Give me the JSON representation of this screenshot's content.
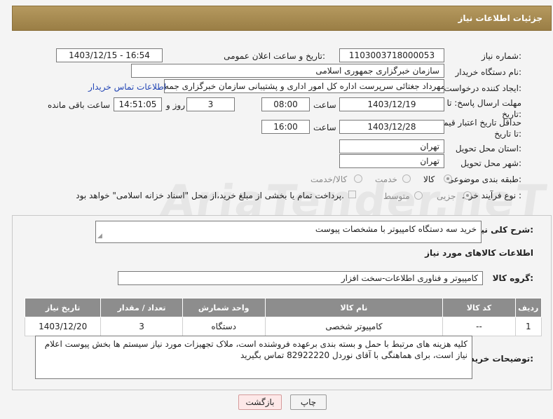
{
  "header": {
    "title": "جزئیات اطلاعات نیاز"
  },
  "form": {
    "need_number_label": "شماره نیاز:",
    "need_number": "1103003718000053",
    "announce_label": "تاریخ و ساعت اعلان عمومی:",
    "announce_value": "1403/12/15 - 16:54",
    "buyer_org_label": "نام دستگاه خریدار:",
    "buyer_org": "سازمان خبرگزاری جمهوری اسلامی",
    "creator_label": "ایجاد کننده درخواست:",
    "creator": "مهرداد جغتائی سرپرست اداره کل امور اداری و پشتیبانی سازمان خبرگزاری جمه",
    "contact_link": "اطلاعات تماس خریدار",
    "deadline_label": "مهلت ارسال پاسخ: تا تاریخ:",
    "deadline_date": "1403/12/19",
    "hour_label": "ساعت",
    "deadline_time": "08:00",
    "days_value": "3",
    "days_label": "روز و",
    "remaining_time": "14:51:05",
    "remaining_label": "ساعت باقی مانده",
    "min_price_label": "حداقل تاریخ اعتبار قیمت: تا تاریخ:",
    "min_price_date": "1403/12/28",
    "min_price_hour_label": "ساعت",
    "min_price_time": "16:00",
    "province_label": "استان محل تحویل:",
    "province": "تهران",
    "city_label": "شهر محل تحویل:",
    "city": "تهران",
    "category_label": "طبقه بندی موضوعی:",
    "category_options": [
      "کالا",
      "خدمت",
      "کالا/خدمت"
    ],
    "process_label": "نوع فرآیند خرید :",
    "process_options": [
      "جزیی",
      "متوسط"
    ],
    "payment_note": "پرداخت تمام یا بخشی از مبلغ خرید،از محل \"اسناد خزانه اسلامی\" خواهد بود."
  },
  "summary": {
    "label": "شرح کلی نیاز:",
    "value": "خرید سه دستگاه کامپیوتر با مشخصات پیوست"
  },
  "goods": {
    "section_title": "اطلاعات کالاهای مورد نیاز",
    "group_label": "گروه کالا:",
    "group_value": "کامپیوتر و فناوری اطلاعات-سخت افزار",
    "columns": [
      "ردیف",
      "کد کالا",
      "نام کالا",
      "واحد شمارش",
      "تعداد / مقدار",
      "تاریخ نیاز"
    ],
    "rows": [
      [
        "1",
        "--",
        "کامپیوتر شخصی",
        "دستگاه",
        "3",
        "1403/12/20"
      ]
    ]
  },
  "buyer_notes": {
    "label": "توضیحات خریدار:",
    "value": "کلیه هزینه های مرتبط با حمل و بسته بندی برعهده فروشنده است، ملاک تجهیزات مورد نیاز سیستم ها بخش پیوست اعلام نیاز است، برای هماهنگی با آقای نوردل 82922220 تماس بگیرید"
  },
  "buttons": {
    "print": "چاپ",
    "back": "بازگشت"
  },
  "watermark": "AriaTender.neT",
  "colors": {
    "header": "#a68a50",
    "table_header": "#8d8d8d",
    "link": "#2346b5"
  }
}
